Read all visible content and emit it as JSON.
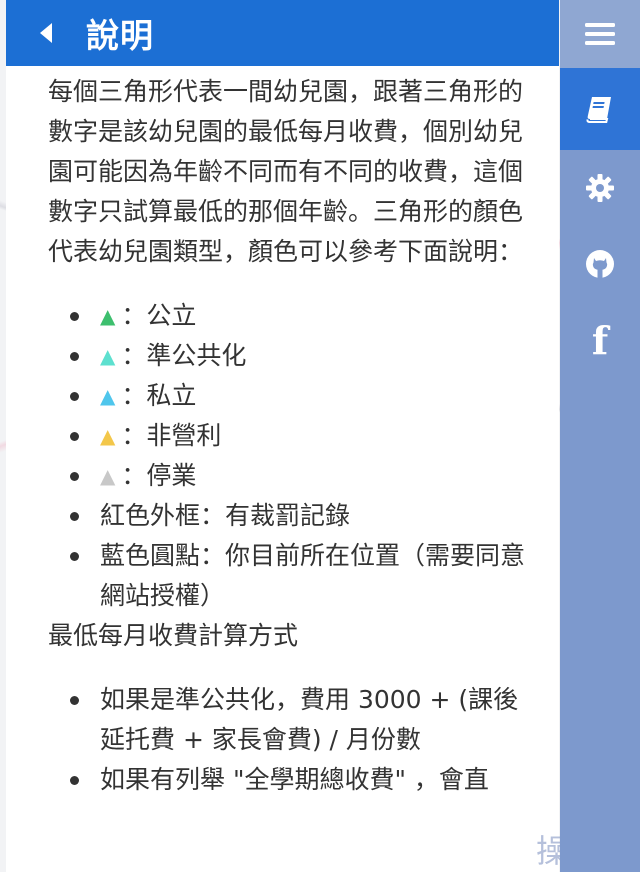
{
  "header": {
    "title": "說明"
  },
  "intro": "每個三角形代表一間幼兒園，跟著三角形的數字是該幼兒園的最低每月收費，個別幼兒園可能因為年齡不同而有不同的收費，這個數字只試算最低的那個年齡。三角形的顏色代表幼兒園類型，顏色可以參考下面說明：",
  "legend": [
    {
      "symbol": "▲",
      "color": "#3dbf6e",
      "label": "：公立"
    },
    {
      "symbol": "▲",
      "color": "#5de0cf",
      "label": "：準公共化"
    },
    {
      "symbol": "▲",
      "color": "#4fc6ec",
      "label": "：私立"
    },
    {
      "symbol": "▲",
      "color": "#f3c74a",
      "label": "：非營利"
    },
    {
      "symbol": "▲",
      "color": "#c8c8c8",
      "label": "：停業"
    },
    {
      "label": "紅色外框：有裁罰記錄"
    },
    {
      "label": "藍色圓點：你目前所在位置（需要同意網站授權）"
    }
  ],
  "fee_section_title": "最低每月收費計算方式",
  "fee_rules": [
    "如果是準公共化，費用 3000 + (課後延托費 + 家長會費) / 月份數",
    "如果有列舉 \"全學期總收費\" ，會直"
  ],
  "map_overlay_text": "操作",
  "colors": {
    "header_bg": "#1c6fd4",
    "sidebar_bg": "#7d99cd",
    "sidebar_active": "#2f74d6"
  },
  "sidebar_icons": [
    "menu-icon",
    "book-icon",
    "gear-icon",
    "github-icon",
    "facebook-icon"
  ]
}
